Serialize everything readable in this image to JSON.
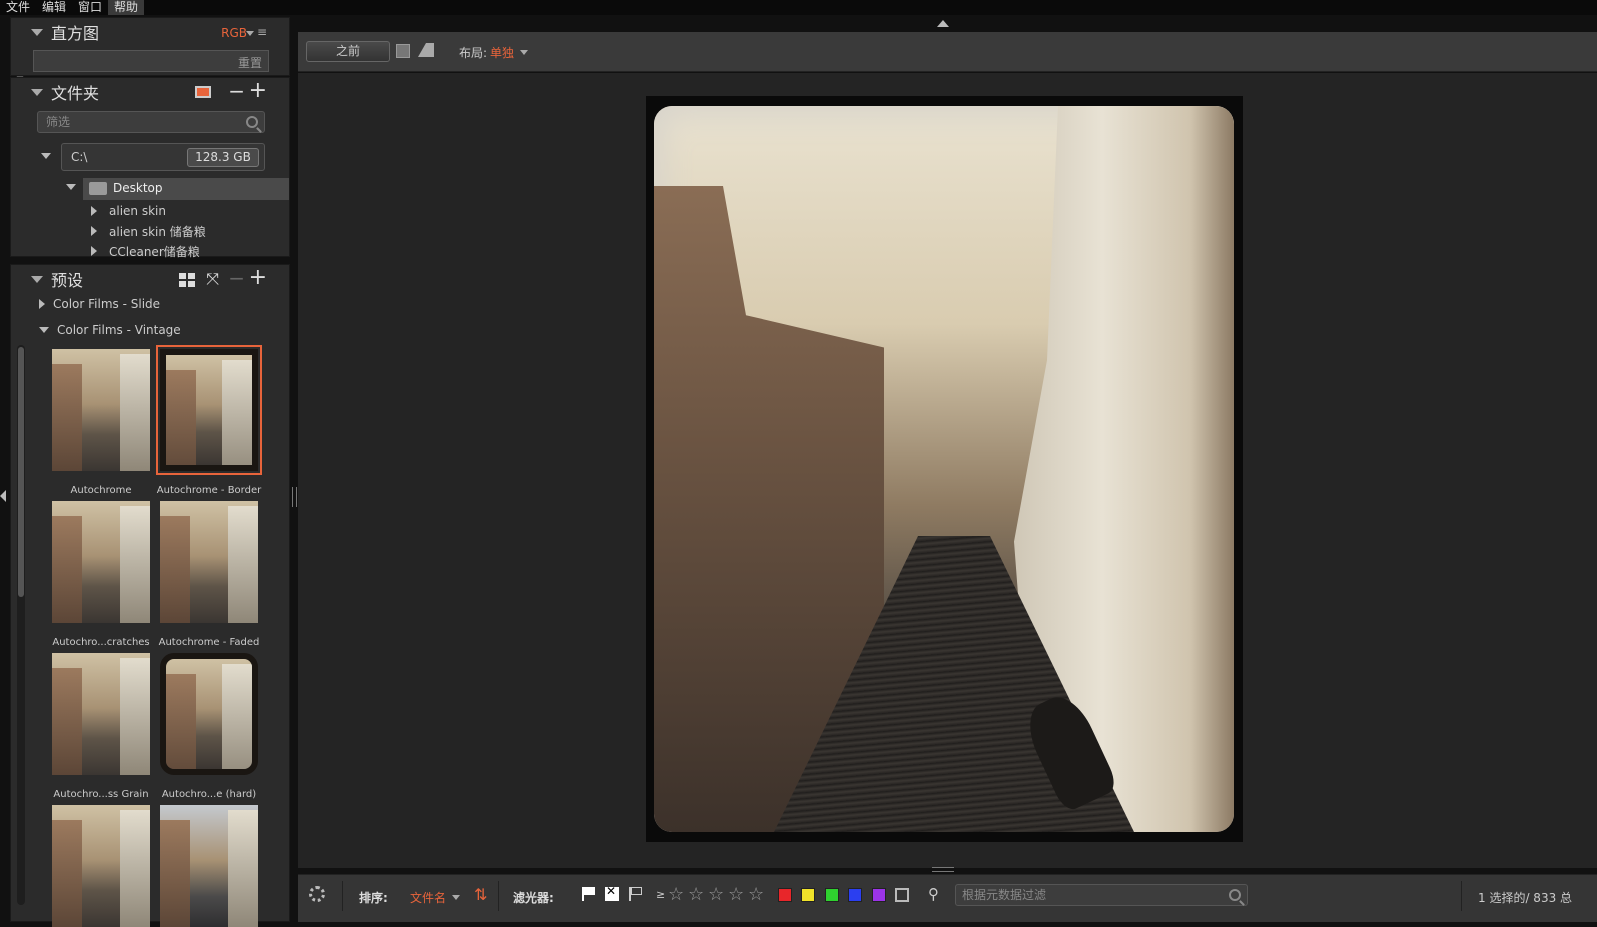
{
  "menubar": {
    "items": [
      "文件",
      "编辑",
      "窗口",
      "帮助"
    ]
  },
  "histogram": {
    "title": "直方图",
    "channel": "RGB",
    "reset_label": "重置"
  },
  "folders": {
    "title": "文件夹",
    "filter_placeholder": "筛选",
    "drive": {
      "label": "C:\\",
      "free": "128.3 GB"
    },
    "desktop": "Desktop",
    "children": [
      "alien skin",
      "alien skin 储备粮",
      "CCleaner储备粮"
    ]
  },
  "presets": {
    "title": "预设",
    "categories": [
      "Color Films - Slide",
      "Color Films - Vintage"
    ],
    "thumbs": [
      {
        "label": "Autochrome"
      },
      {
        "label": "Autochrome - Border"
      },
      {
        "label": "Autochro...cratches"
      },
      {
        "label": "Autochrome - Faded"
      },
      {
        "label": "Autochro...ss Grain"
      },
      {
        "label": "Autochro...e (hard)"
      }
    ]
  },
  "toolbar": {
    "before_label": "之前",
    "layout_label": "布局:",
    "layout_value": "单独"
  },
  "bottombar": {
    "sort_label": "排序:",
    "sort_value": "文件名",
    "filter_label": "滤光器:",
    "gte": "≥",
    "stars": [
      "☆",
      "☆",
      "☆",
      "☆",
      "☆"
    ],
    "colors": [
      "#e8262a",
      "#f0e22a",
      "#2fd12f",
      "#2b3ff0",
      "#9b34e8"
    ],
    "meta_filter_placeholder": "根据元数据过滤",
    "status": "1 选择的/ 833 总"
  },
  "accent_color": "#e8643b"
}
